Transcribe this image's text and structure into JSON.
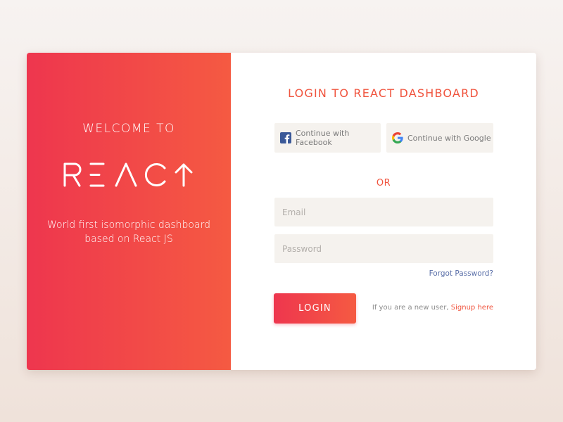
{
  "welcome": {
    "heading": "WELCOME TO",
    "logo_text": "REACT",
    "tagline": "World first isomorphic dashboard based on React JS"
  },
  "login": {
    "title": "LOGIN TO REACT DASHBOARD",
    "facebook_label": "Continue with Facebook",
    "google_label": "Continue with Google",
    "or_text": "OR",
    "email_placeholder": "Email",
    "password_placeholder": "Password",
    "forgot_label": "Forgot Password?",
    "login_label": "LOGIN",
    "signup_prefix": "If you are a new user,",
    "signup_link": "Signup here"
  },
  "colors": {
    "accent": "#f0543e",
    "gradient_start": "#ee364e",
    "gradient_end": "#f55a42",
    "link_blue": "#5a6fa8",
    "field_bg": "#f5f2ee"
  },
  "icons": {
    "facebook": "facebook-icon",
    "google": "google-icon",
    "logo": "react-logo"
  }
}
